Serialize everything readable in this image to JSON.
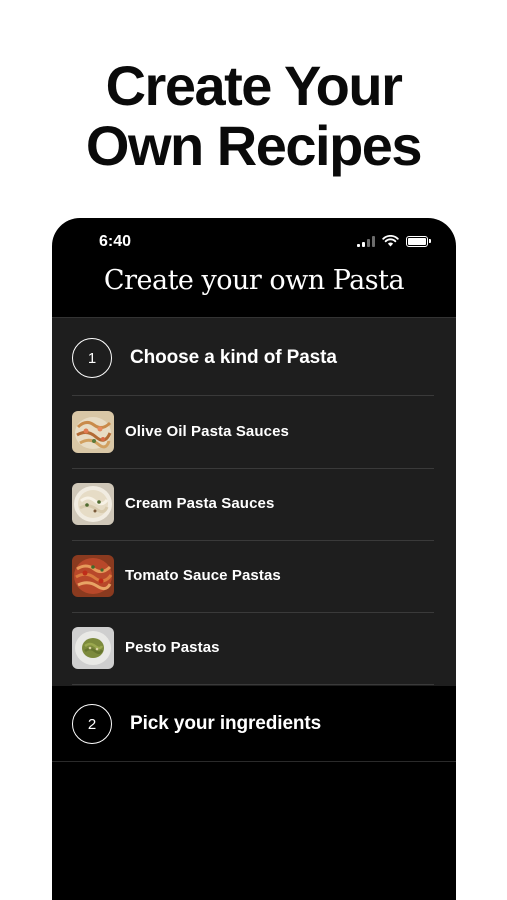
{
  "headline": {
    "line1": "Create Your",
    "line2": "Own Recipes"
  },
  "status_bar": {
    "time": "6:40",
    "icons": [
      "cellular-signal-icon",
      "wifi-icon",
      "battery-icon"
    ]
  },
  "screen": {
    "title": "Create your own Pasta"
  },
  "steps": [
    {
      "number": "1",
      "label": "Choose a kind of Pasta",
      "items": [
        {
          "label": "Olive Oil Pasta Sauces",
          "thumbnail": "olive-oil-pasta-thumbnail"
        },
        {
          "label": "Cream Pasta Sauces",
          "thumbnail": "cream-pasta-thumbnail"
        },
        {
          "label": "Tomato Sauce Pastas",
          "thumbnail": "tomato-sauce-pasta-thumbnail"
        },
        {
          "label": "Pesto Pastas",
          "thumbnail": "pesto-pasta-thumbnail"
        }
      ]
    },
    {
      "number": "2",
      "label": "Pick your ingredients"
    }
  ],
  "colors": {
    "page_background": "#ffffff",
    "headline_text": "#0a0a0a",
    "phone_background": "#000000",
    "section_background": "#1e1e1e",
    "divider": "#3a3a3a",
    "text": "#ffffff"
  }
}
